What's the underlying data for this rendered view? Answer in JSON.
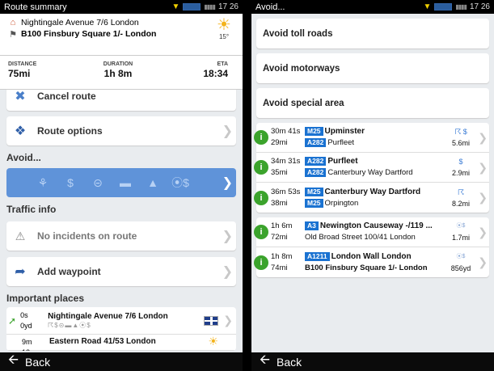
{
  "left": {
    "status_title": "Route summary",
    "status_time": "17 26",
    "from": "Nightingale Avenue 7/6  London",
    "to": "B100 Finsbury Square 1/-  London",
    "weather_temp": "15°",
    "distance_label": "DISTANCE",
    "distance_value": "75mi",
    "duration_label": "DURATION",
    "duration_value": "1h 8m",
    "eta_label": "ETA",
    "eta_value": "18:34",
    "cancel_route": "Cancel route",
    "route_options": "Route options",
    "avoid_title": "Avoid...",
    "avoid_icons": [
      "toll-icon",
      "dollar-icon",
      "no-entry-icon",
      "ferry-icon",
      "tunnel-icon",
      "special-area-icon"
    ],
    "traffic_title": "Traffic info",
    "no_incidents": "No incidents on route",
    "add_waypoint": "Add waypoint",
    "important_title": "Important places",
    "places": [
      {
        "time": "0s",
        "dist": "0yd",
        "name": "Nightingale Avenue 7/6  London",
        "sub": "☈$⊝▬▲⦿$"
      },
      {
        "time": "9m 12s",
        "dist": "",
        "name": "Eastern Road 41/53  London",
        "sub": ""
      }
    ],
    "back_label": "Back"
  },
  "right": {
    "status_title": "Avoid...",
    "status_time": "17 26",
    "avoid_items": [
      "Avoid toll roads",
      "Avoid motorways",
      "Avoid special area"
    ],
    "group1": [
      {
        "time": "30m 41s",
        "dist": "29mi",
        "road1": "M25",
        "street1": "Upminster",
        "road2": "A282",
        "street2": "Purfleet",
        "sym": "☈ $",
        "len": "5.6mi"
      },
      {
        "time": "34m 31s",
        "dist": "35mi",
        "road1": "A282",
        "street1": "Purfleet",
        "road2": "A282",
        "street2": "Canterbury Way  Dartford",
        "sym": "$",
        "len": "2.9mi"
      },
      {
        "time": "36m 53s",
        "dist": "38mi",
        "road1": "M25",
        "street1": "Canterbury Way  Dartford",
        "road2": "M25",
        "street2": "Orpington",
        "sym": "☈",
        "len": "8.2mi"
      }
    ],
    "group2": [
      {
        "time": "1h 6m",
        "dist": "72mi",
        "road1": "A3",
        "street1": "Newington Causeway -/119 ...",
        "road2": "",
        "street2": "Old Broad Street 100/41  London",
        "sym": "⦿$",
        "len": "1.7mi",
        "bold2": false
      },
      {
        "time": "1h 8m",
        "dist": "74mi",
        "road1": "A1211",
        "street1": "London Wall  London",
        "road2": "",
        "street2": "B100 Finsbury Square 1/-  London",
        "sym": "⦿$",
        "len": "856yd",
        "bold2": true
      }
    ],
    "back_label": "Back"
  }
}
